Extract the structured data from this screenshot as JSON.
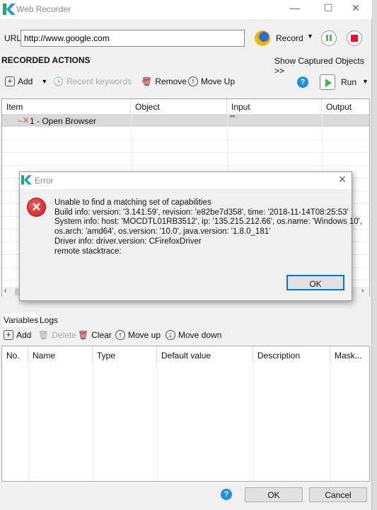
{
  "window": {
    "title": "Web Recorder"
  },
  "url": {
    "label": "URL",
    "value": "http://www.google.com"
  },
  "record": {
    "label": "Record"
  },
  "section": {
    "title": "RECORDED ACTIONS",
    "show_captured": "Show Captured Objects >>"
  },
  "toolbar": {
    "add": "Add",
    "recent": "Recent keywords",
    "remove": "Remove",
    "move_up": "Move Up",
    "run": "Run"
  },
  "actions_table": {
    "columns": [
      "Item",
      "Object",
      "Input",
      "Output"
    ],
    "rows": [
      {
        "item": "1 - Open Browser",
        "object": "",
        "input": "\"\"",
        "output": ""
      }
    ]
  },
  "tabs": [
    "Variables",
    "Logs"
  ],
  "var_toolbar": {
    "add": "Add",
    "delete": "Delete",
    "clear": "Clear",
    "move_up": "Move up",
    "move_down": "Move down"
  },
  "var_table": {
    "columns": [
      "No.",
      "Name",
      "Type",
      "Default value",
      "Description",
      "Mask..."
    ]
  },
  "footer": {
    "ok": "OK",
    "cancel": "Cancel"
  },
  "dialog": {
    "title": "Error",
    "lines": [
      "Unable to find a matching set of capabilities",
      "Build info: version: '3.141.59', revision: 'e82be7d358', time: '2018-11-14T08:25:53'",
      "System info: host: 'MOCDTL01RB3512', ip: '135.215.212.66', os.name: 'Windows 10',",
      "os.arch: 'amd64', os.version: '10.0', java.version: '1.8.0_181'",
      "Driver info: driver.version: CFirefoxDriver",
      "remote stacktrace:"
    ],
    "ok": "OK"
  },
  "colors": {
    "accent": "#0078d7",
    "error": "#d9272e",
    "help": "#1e90e0",
    "run": "#4caf50"
  }
}
